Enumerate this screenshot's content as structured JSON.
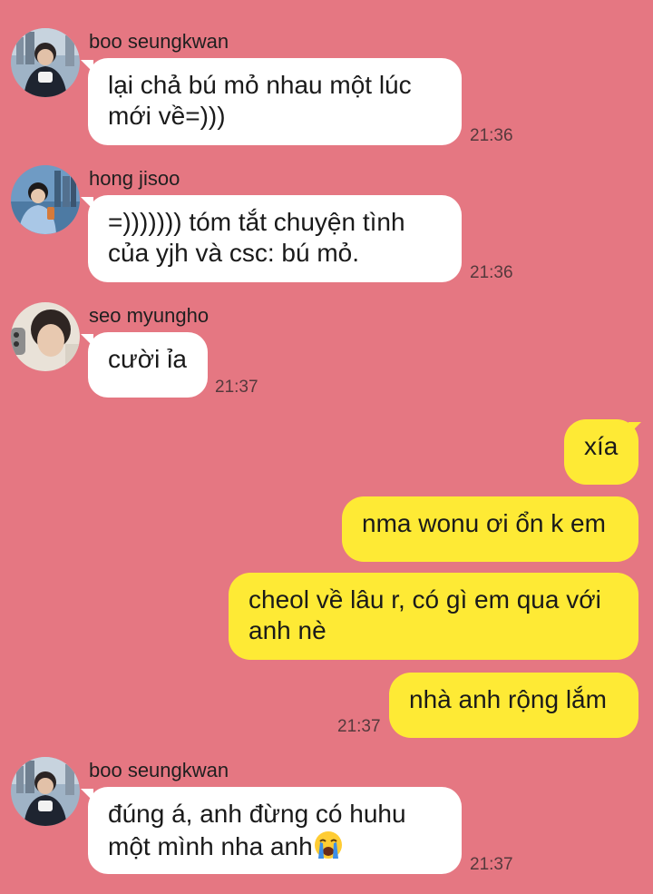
{
  "messages": [
    {
      "sender": "boo seungkwan",
      "avatar": "boo-seungkwan-avatar",
      "lines": [
        "lại chả bú mỏ nhau một lúc",
        "mới về=)))"
      ],
      "time": "21:36"
    },
    {
      "sender": "hong jisoo",
      "avatar": "hong-jisoo-avatar",
      "lines": [
        "=))))))) tóm tắt chuyện tình",
        "của yjh và csc: bú mỏ."
      ],
      "time": "21:36"
    },
    {
      "sender": "seo myungho",
      "avatar": "seo-myungho-avatar",
      "lines": [
        "cười ỉa"
      ],
      "time": "21:37"
    }
  ],
  "outgoing": {
    "bubbles": [
      {
        "lines": [
          "xía"
        ]
      },
      {
        "lines": [
          "nma wonu ơi ổn k em"
        ]
      },
      {
        "lines": [
          "cheol về lâu r, có gì em qua với",
          "anh nè"
        ]
      },
      {
        "lines": [
          "nhà anh rộng lắm"
        ]
      }
    ],
    "time": "21:37"
  },
  "last_message": {
    "sender": "boo seungkwan",
    "avatar": "boo-seungkwan-avatar",
    "line1": "đúng á, anh đừng có huhu",
    "line2": "một mình nha anh",
    "emoji": "loudly-crying-face-icon",
    "time": "21:37"
  },
  "colors": {
    "background": "#e57782",
    "incoming_bubble": "#ffffff",
    "outgoing_bubble": "#feea35"
  }
}
